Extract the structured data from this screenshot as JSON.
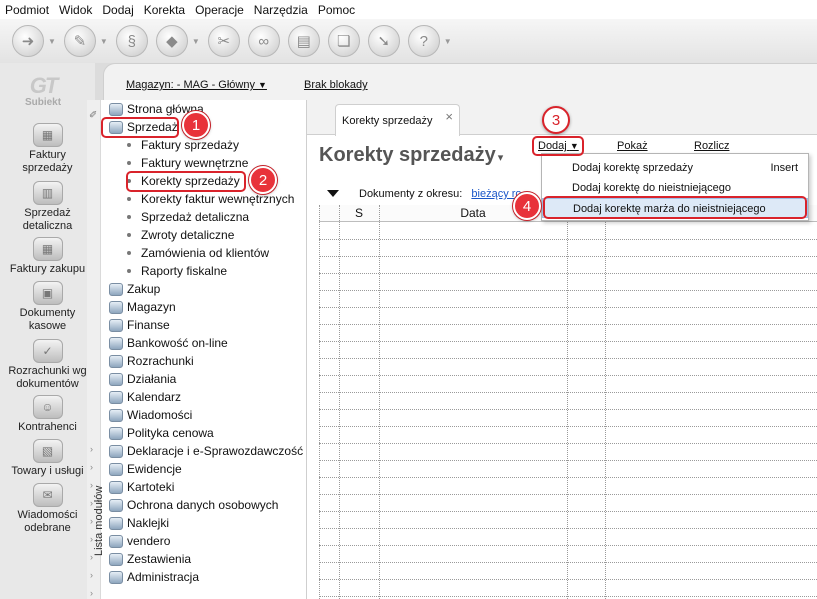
{
  "menubar": [
    "Podmiot",
    "Widok",
    "Dodaj",
    "Korekta",
    "Operacje",
    "Narzędzia",
    "Pomoc"
  ],
  "toolbar_icons": [
    "new-icon",
    "edit-icon",
    "documents-icon",
    "tag-icon",
    "attach-icon",
    "link-icon",
    "print-icon",
    "copy-icon",
    "export-icon",
    "help-icon"
  ],
  "logo": {
    "label": "Subiekt"
  },
  "launcher": [
    {
      "label": "Faktury sprzedaży",
      "icon": "invoices-icon"
    },
    {
      "label": "Sprzedaż detaliczna",
      "icon": "retail-icon"
    },
    {
      "label": "Faktury zakupu",
      "icon": "purchase-invoices-icon"
    },
    {
      "label": "Dokumenty kasowe",
      "icon": "cash-documents-icon"
    },
    {
      "label": "Rozrachunki wg dokumentów",
      "icon": "settlements-icon"
    },
    {
      "label": "Kontrahenci",
      "icon": "contractors-icon"
    },
    {
      "label": "Towary i usługi",
      "icon": "goods-icon"
    },
    {
      "label": "Wiadomości odebrane",
      "icon": "messages-icon"
    }
  ],
  "header": {
    "magazyn": "Magazyn: - MAG - Główny",
    "blokada": "Brak blokady"
  },
  "tree": {
    "strip_label": "Lista modułów",
    "nodes": [
      "Strona główna",
      "Sprzedaż",
      "Zakup",
      "Magazyn",
      "Finanse",
      "Bankowość on-line",
      "Rozrachunki",
      "Działania",
      "Kalendarz",
      "Wiadomości",
      "Polityka cenowa",
      "Deklaracje i e-Sprawozdawczość",
      "Ewidencje",
      "Kartoteki",
      "Ochrona danych osobowych",
      "Naklejki",
      "vendero",
      "Zestawienia",
      "Administracja"
    ],
    "sub": [
      "Faktury sprzedaży",
      "Faktury wewnętrzne",
      "Korekty sprzedaży",
      "Korekty faktur wewnętrznych",
      "Sprzedaż detaliczna",
      "Zwroty detaliczne",
      "Zamówienia od klientów",
      "Raporty fiskalne"
    ]
  },
  "tab": {
    "label": "Korekty sprzedaży"
  },
  "main": {
    "title": "Korekty sprzedaży",
    "dodaj": "Dodaj",
    "pokaz": "Pokaż",
    "rozlicz": "Rozlicz",
    "period_label": "Dokumenty z okresu:",
    "period_value": "bieżący ro"
  },
  "grid": {
    "columns": [
      "S",
      "Data"
    ]
  },
  "menu": [
    {
      "label": "Dodaj korektę sprzedaży",
      "shortcut": "Insert"
    },
    {
      "label": "Dodaj korektę do nieistniejącego",
      "shortcut": ""
    },
    {
      "label": "Dodaj korektę marża do nieistniejącego",
      "shortcut": ""
    }
  ],
  "badges": [
    "1",
    "2",
    "3",
    "4"
  ],
  "colors": {
    "annotation": "#d9232b",
    "link": "#1a56c8",
    "highlight": "#dde9f7"
  }
}
